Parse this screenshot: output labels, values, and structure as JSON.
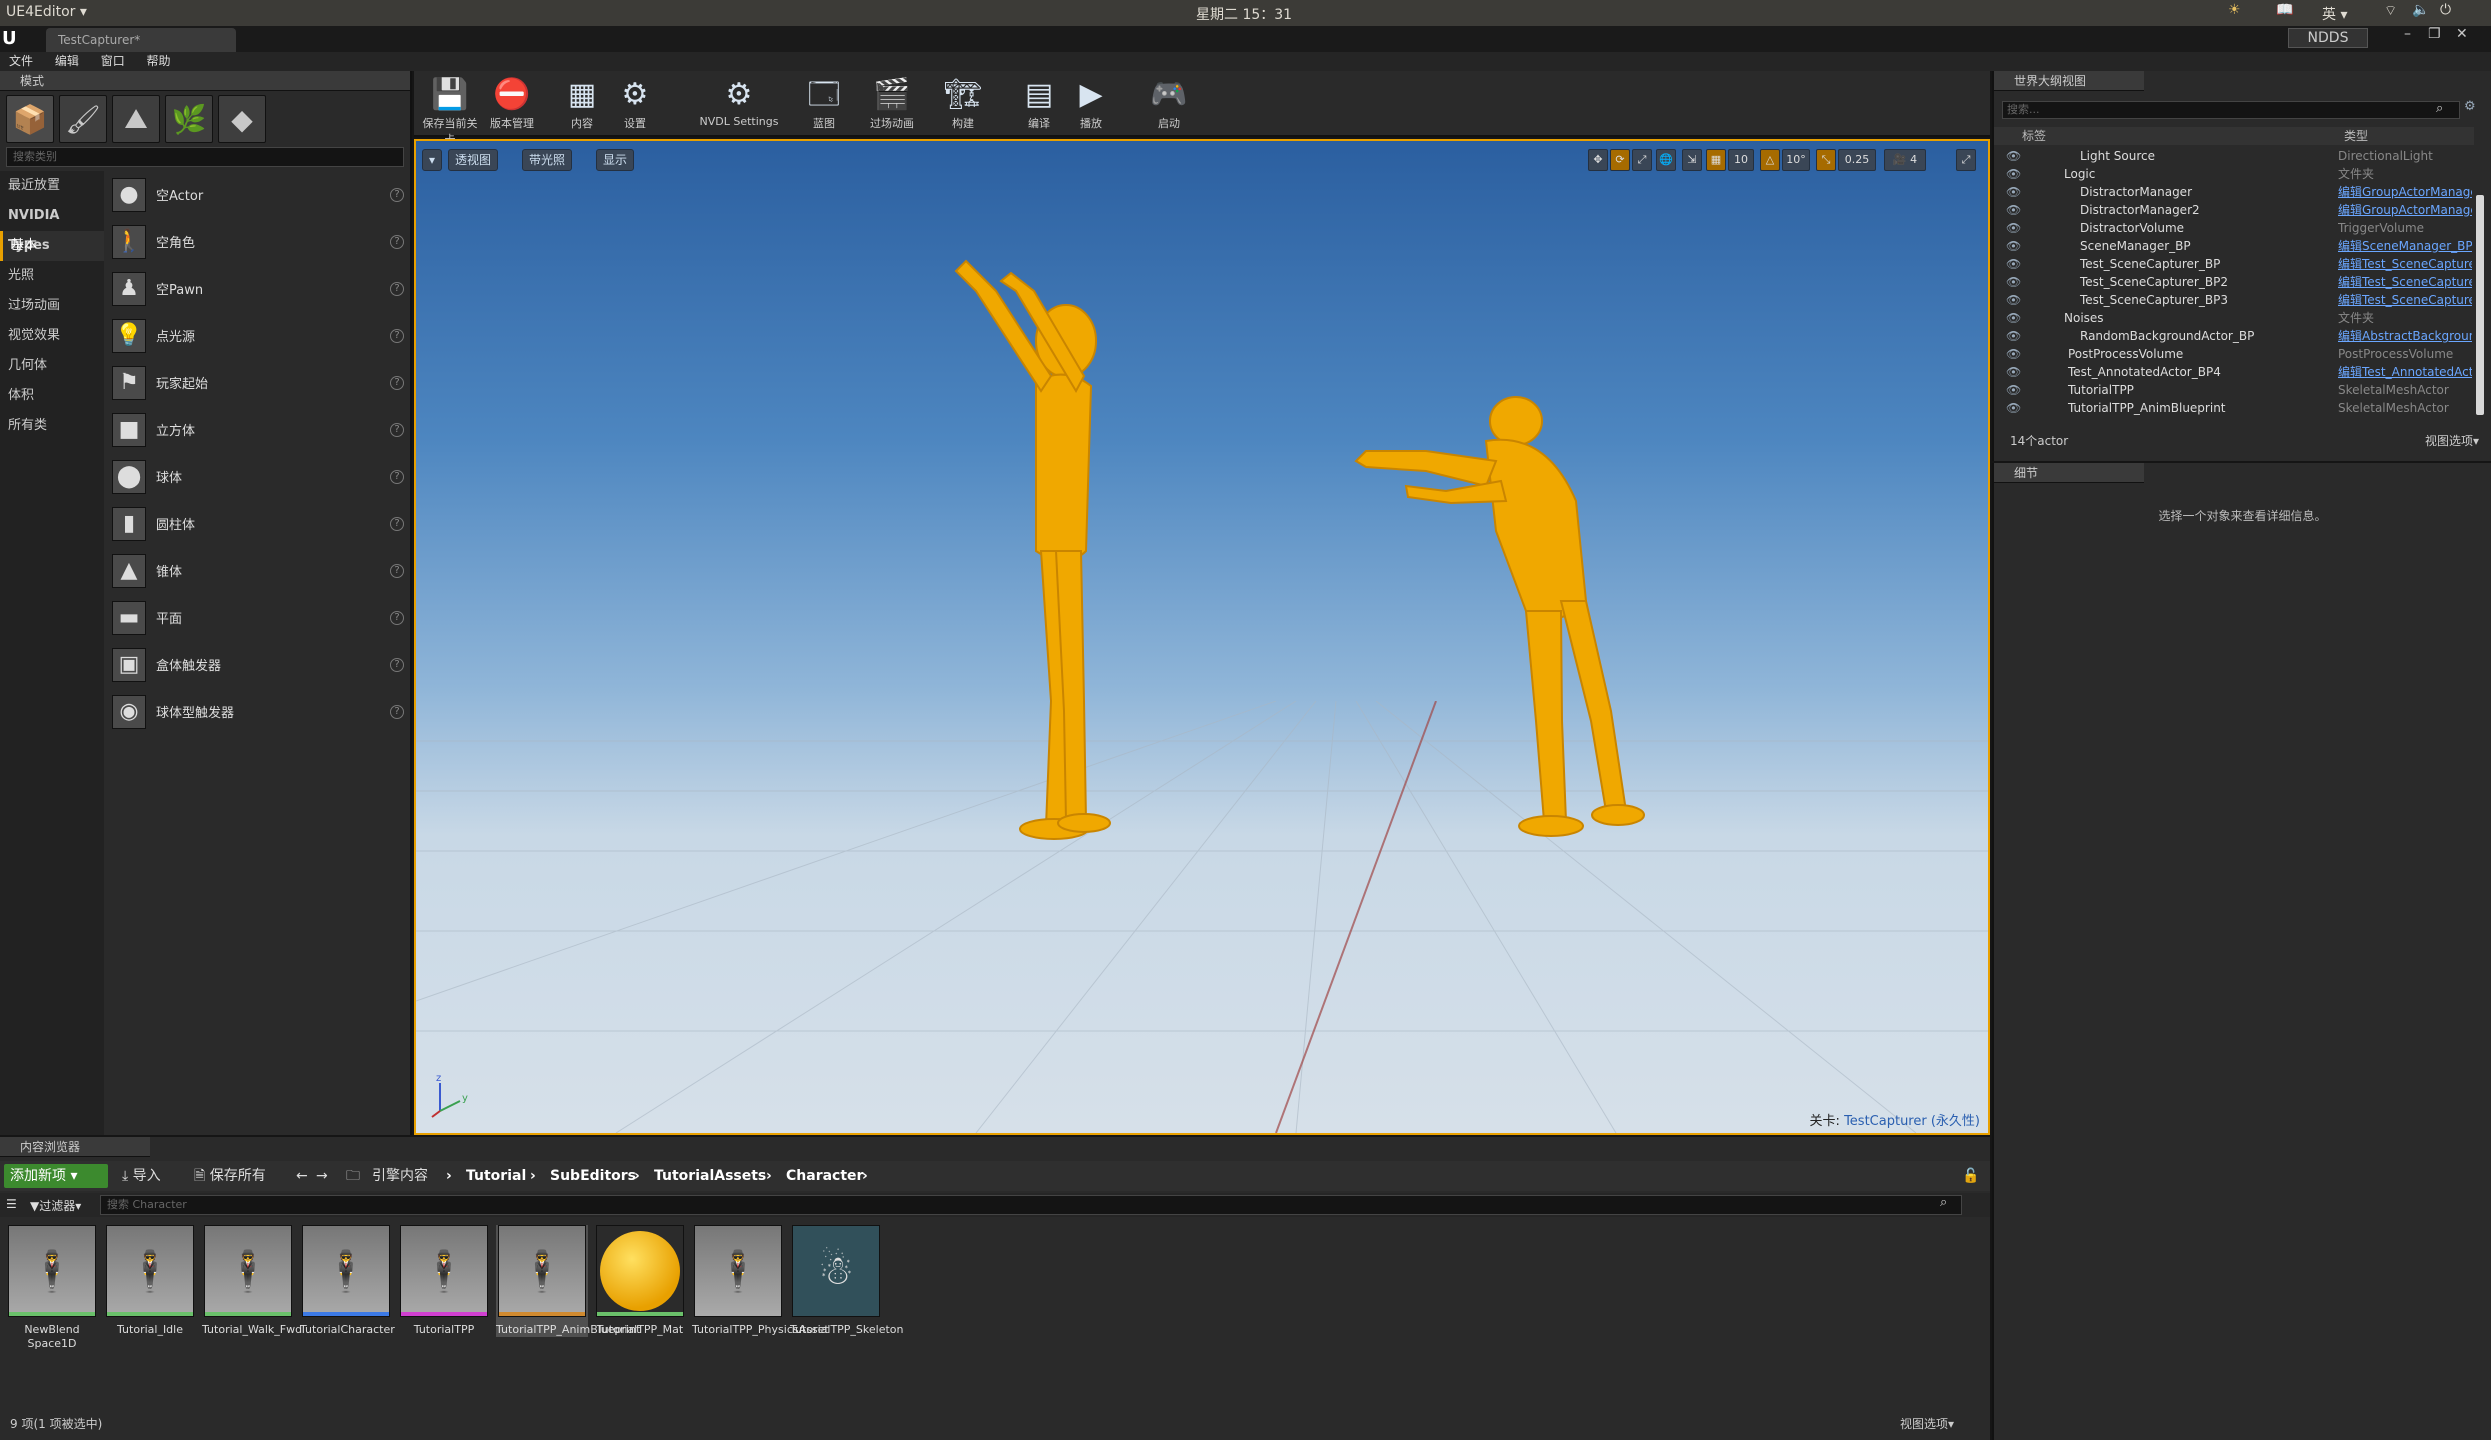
{
  "system": {
    "app_menu": "UE4Editor ▾",
    "clock": "星期二 15：31",
    "input_method": "英 ▾",
    "ndds": "NDDS"
  },
  "tab": {
    "title": "TestCapturer*"
  },
  "menu": [
    "文件",
    "编辑",
    "窗口",
    "帮助"
  ],
  "modes": {
    "title": "模式",
    "search_placeholder": "搜索类别",
    "categories": [
      "最近放置",
      "NVIDIA Types",
      "基本",
      "光照",
      "过场动画",
      "视觉效果",
      "几何体",
      "体积",
      "所有类"
    ],
    "items": [
      "空Actor",
      "空角色",
      "空Pawn",
      "点光源",
      "玩家起始",
      "立方体",
      "球体",
      "圆柱体",
      "锥体",
      "平面",
      "盒体触发器",
      "球体型触发器"
    ]
  },
  "toolbar": [
    "保存当前关卡",
    "版本管理",
    "内容",
    "设置",
    "NVDL Settings",
    "蓝图",
    "过场动画",
    "构建",
    "编译",
    "播放",
    "启动"
  ],
  "viewport": {
    "perspective": "透视图",
    "lit": "带光照",
    "show": "显示",
    "grid": "10",
    "rotation": "10°",
    "scale": "0.25",
    "camera_speed": "4",
    "level_prefix": "关卡:",
    "level_name": "TestCapturer (永久性)"
  },
  "outliner": {
    "title": "世界大纲视图",
    "search_placeholder": "搜索...",
    "col_label": "标签",
    "col_type": "类型",
    "rows": [
      {
        "name": "Light Source",
        "type": "DirectionalLight",
        "link": false
      },
      {
        "name": "Logic",
        "type": "文件夹",
        "link": false
      },
      {
        "name": "DistractorManager",
        "type": "编辑GroupActorManager",
        "link": true
      },
      {
        "name": "DistractorManager2",
        "type": "编辑GroupActorManager",
        "link": true
      },
      {
        "name": "DistractorVolume",
        "type": "TriggerVolume",
        "link": false
      },
      {
        "name": "SceneManager_BP",
        "type": "编辑SceneManager_BP",
        "link": true
      },
      {
        "name": "Test_SceneCapturer_BP",
        "type": "编辑Test_SceneCapturer",
        "link": true
      },
      {
        "name": "Test_SceneCapturer_BP2",
        "type": "编辑Test_SceneCapturer",
        "link": true
      },
      {
        "name": "Test_SceneCapturer_BP3",
        "type": "编辑Test_SceneCapturer",
        "link": true
      },
      {
        "name": "Noises",
        "type": "文件夹",
        "link": false
      },
      {
        "name": "RandomBackgroundActor_BP",
        "type": "编辑AbstractBackground",
        "link": true
      },
      {
        "name": "PostProcessVolume",
        "type": "PostProcessVolume",
        "link": false
      },
      {
        "name": "Test_AnnotatedActor_BP4",
        "type": "编辑Test_AnnotatedActor",
        "link": true
      },
      {
        "name": "TutorialTPP",
        "type": "SkeletalMeshActor",
        "link": false
      },
      {
        "name": "TutorialTPP_AnimBlueprint",
        "type": "SkeletalMeshActor",
        "link": false
      }
    ],
    "count": "14个actor",
    "view_options": "视图选项▾"
  },
  "details": {
    "title": "细节",
    "empty_msg": "选择一个对象来查看详细信息。"
  },
  "content_browser": {
    "title": "内容浏览器",
    "add_new": "添加新项 ▾",
    "import": "导入",
    "save_all": "保存所有",
    "path": [
      "引擎内容",
      "Tutorial",
      "SubEditors",
      "TutorialAssets",
      "Character"
    ],
    "filters": "过滤器▾",
    "search_placeholder": "搜索 Character",
    "assets": [
      "NewBlend Space1D",
      "Tutorial_Idle",
      "Tutorial_Walk_Fwd",
      "TutorialCharacter",
      "TutorialTPP",
      "TutorialTPP_AnimBlueprint",
      "TutorialTPP_Mat",
      "TutorialTPP_PhysicsAsset",
      "TutorialTPP_Skeleton"
    ],
    "status": "9 项(1 项被选中)",
    "view_options": "视图选项▾"
  }
}
